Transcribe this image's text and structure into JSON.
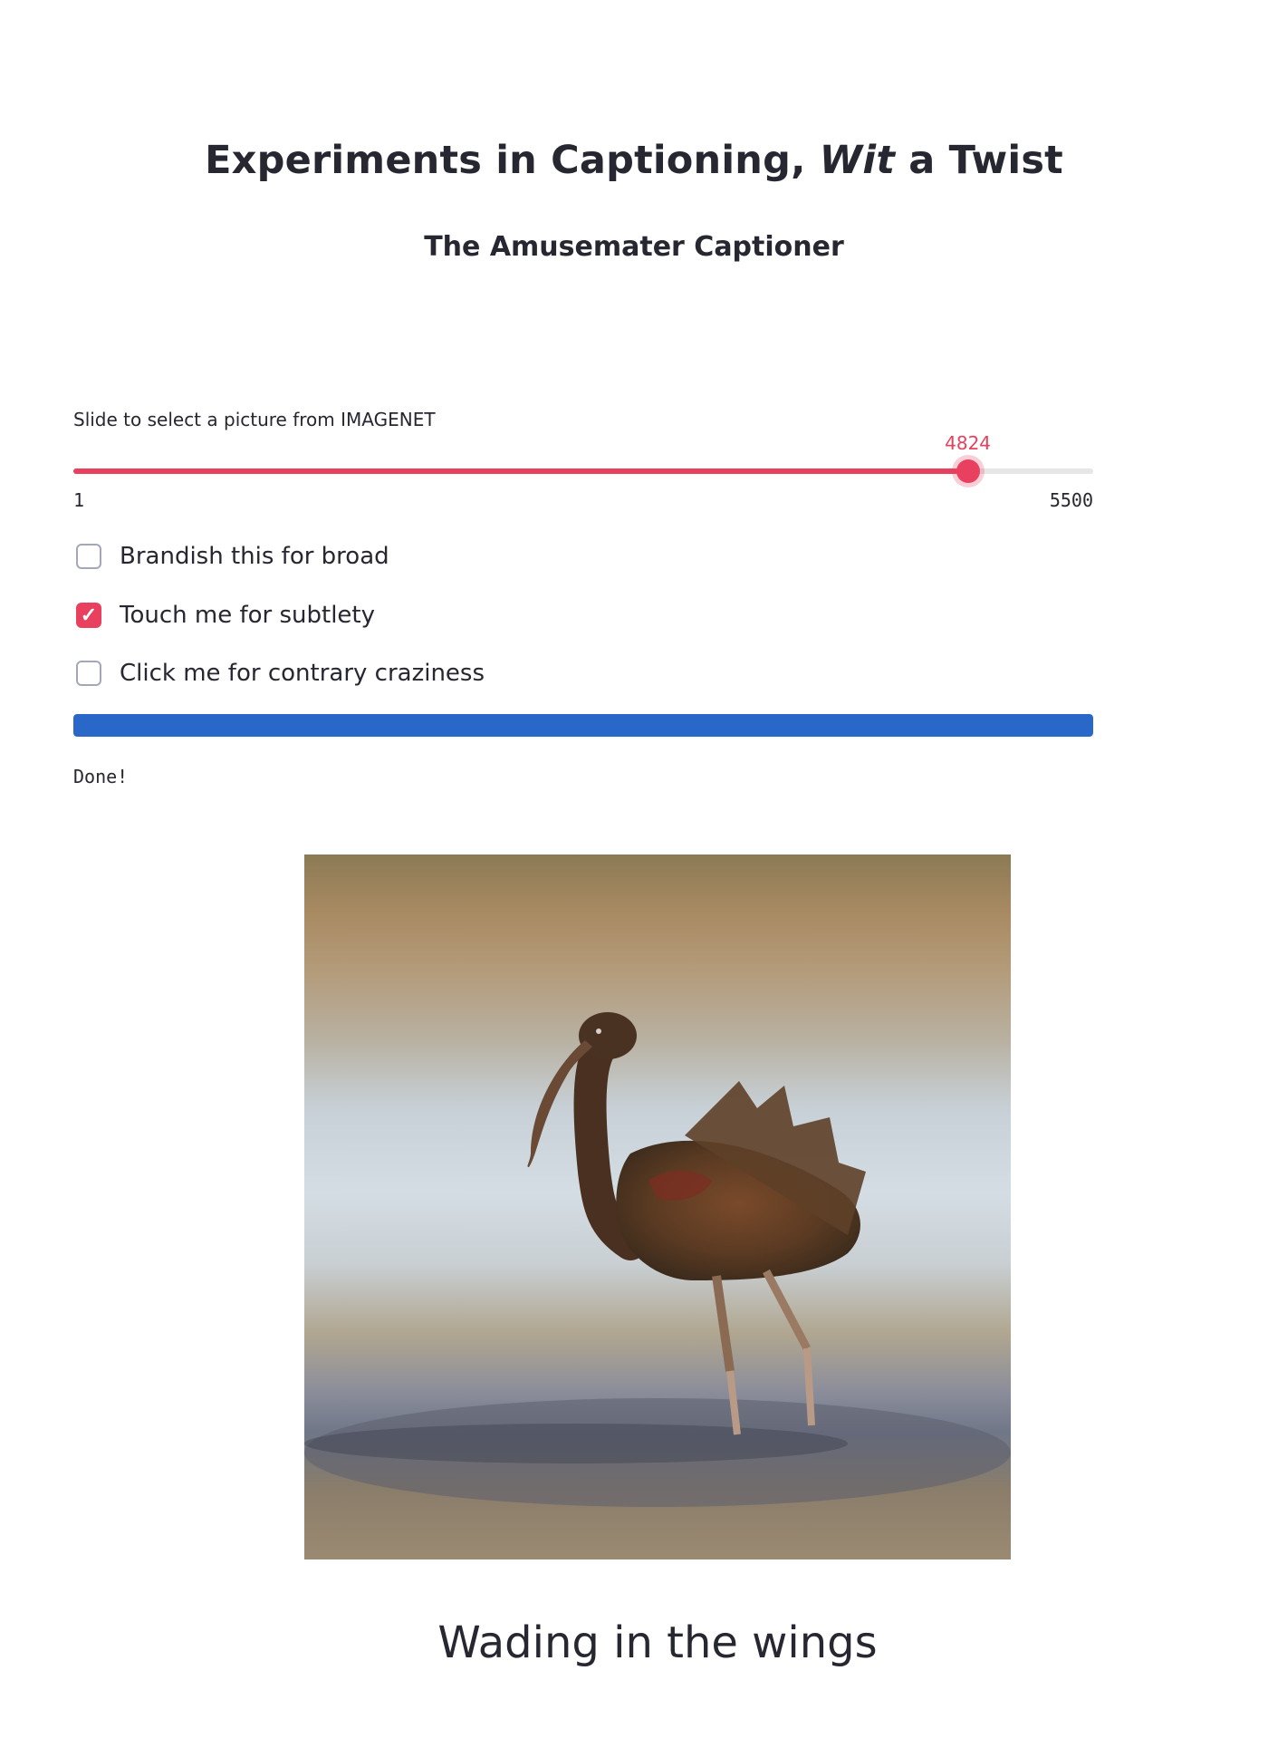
{
  "header": {
    "title_prefix": "Experiments in Captioning, ",
    "title_emphasis": "Wit",
    "title_suffix": " a Twist",
    "subtitle": "The Amusemater Captioner"
  },
  "slider": {
    "label": "Slide to select a picture from IMAGENET",
    "min": 1,
    "max": 5500,
    "value": 4824,
    "min_label": "1",
    "max_label": "5500",
    "value_label": "4824",
    "accent_color": "#e8405e"
  },
  "options": [
    {
      "label": "Brandish this for broad",
      "checked": false
    },
    {
      "label": "Touch me for subtlety",
      "checked": true
    },
    {
      "label": "Click me for contrary craziness",
      "checked": false
    }
  ],
  "progress": {
    "fraction": 1.0,
    "color": "#2968c8",
    "status_text": "Done!"
  },
  "image": {
    "caption": "Wading in the wings"
  }
}
